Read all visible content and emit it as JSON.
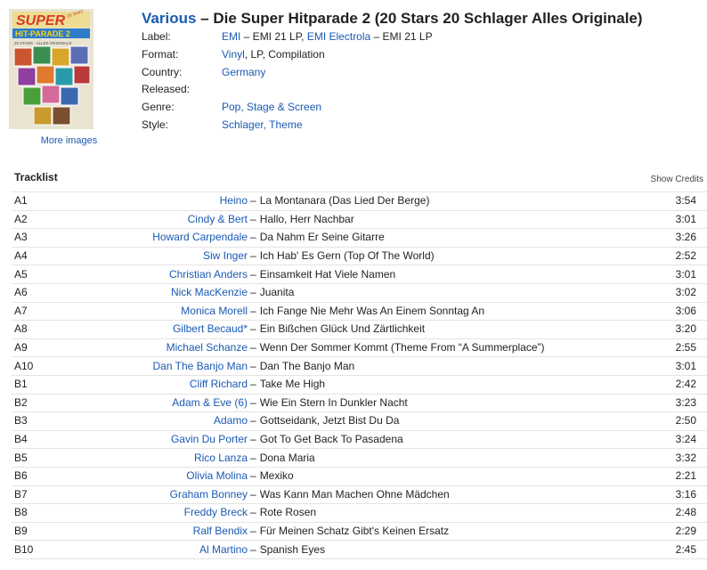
{
  "release": {
    "artist": "Various",
    "title_separator": "–",
    "title": "Die Super Hitparade 2 (20 Stars 20 Schlager Alles Originale)",
    "more_images": "More images"
  },
  "cover": {
    "lettering": "SUPER HIT-PARADE 2 · 20 STARS 20 SCHLAGER ALLES ORIGINALE",
    "colors": {
      "background": "#e9e4d2",
      "title_red": "#d83a2a",
      "title_yellow": "#f3d21e"
    }
  },
  "info": {
    "label": {
      "name": "Label:",
      "parts": [
        "EMI",
        " – EMI 21 LP, ",
        "EMI Electrola",
        " – EMI 21 LP"
      ]
    },
    "format": {
      "name": "Format:",
      "link": "Vinyl",
      "rest": ", LP, Compilation"
    },
    "country": {
      "name": "Country:",
      "value": "Germany"
    },
    "released": {
      "name": "Released:",
      "value": ""
    },
    "genre": {
      "name": "Genre:",
      "value": "Pop, Stage & Screen"
    },
    "style": {
      "name": "Style:",
      "value": "Schlager, Theme"
    }
  },
  "tracklist": {
    "heading": "Tracklist",
    "show_credits": "Show Credits",
    "separator": "–",
    "tracks": [
      {
        "pos": "A1",
        "artist": "Heino",
        "title": "La Montanara (Das Lied Der Berge)",
        "duration": "3:54"
      },
      {
        "pos": "A2",
        "artist": "Cindy & Bert",
        "title": "Hallo, Herr Nachbar",
        "duration": "3:01"
      },
      {
        "pos": "A3",
        "artist": "Howard Carpendale",
        "title": "Da Nahm Er Seine Gitarre",
        "duration": "3:26"
      },
      {
        "pos": "A4",
        "artist": "Siw Inger",
        "title": "Ich Hab' Es Gern (Top Of The World)",
        "duration": "2:52"
      },
      {
        "pos": "A5",
        "artist": "Christian Anders",
        "title": "Einsamkeit Hat Viele Namen",
        "duration": "3:01"
      },
      {
        "pos": "A6",
        "artist": "Nick MacKenzie",
        "title": "Juanita",
        "duration": "3:02"
      },
      {
        "pos": "A7",
        "artist": "Monica Morell",
        "title": "Ich Fange Nie Mehr Was An Einem Sonntag An",
        "duration": "3:06"
      },
      {
        "pos": "A8",
        "artist": "Gilbert Becaud*",
        "title": "Ein Bißchen Glück Und Zärtlichkeit",
        "duration": "3:20"
      },
      {
        "pos": "A9",
        "artist": "Michael Schanze",
        "title": "Wenn Der Sommer Kommt (Theme From “A Summerplace”)",
        "duration": "2:55"
      },
      {
        "pos": "A10",
        "artist": "Dan The Banjo Man",
        "title": "Dan The Banjo Man",
        "duration": "3:01"
      },
      {
        "pos": "B1",
        "artist": "Cliff Richard",
        "title": "Take Me High",
        "duration": "2:42"
      },
      {
        "pos": "B2",
        "artist": "Adam & Eve (6)",
        "title": "Wie Ein Stern In Dunkler Nacht",
        "duration": "3:23"
      },
      {
        "pos": "B3",
        "artist": "Adamo",
        "title": "Gottseidank, Jetzt Bist Du Da",
        "duration": "2:50"
      },
      {
        "pos": "B4",
        "artist": "Gavin Du Porter",
        "title": "Got To Get Back To Pasadena",
        "duration": "3:24"
      },
      {
        "pos": "B5",
        "artist": "Rico Lanza",
        "title": "Dona Maria",
        "duration": "3:32"
      },
      {
        "pos": "B6",
        "artist": "Olivia Molina",
        "title": "Mexiko",
        "duration": "2:21"
      },
      {
        "pos": "B7",
        "artist": "Graham Bonney",
        "title": "Was Kann Man Machen Ohne Mädchen",
        "duration": "3:16"
      },
      {
        "pos": "B8",
        "artist": "Freddy Breck",
        "title": "Rote Rosen",
        "duration": "2:48"
      },
      {
        "pos": "B9",
        "artist": "Ralf Bendix",
        "title": "Für Meinen Schatz Gibt's Keinen Ersatz",
        "duration": "2:29"
      },
      {
        "pos": "B10",
        "artist": "Al Martino",
        "title": "Spanish Eyes",
        "duration": "2:45"
      }
    ]
  },
  "colors": {
    "link": "#1a5ab3",
    "text": "#222222",
    "divider": "#e4e4e4"
  }
}
